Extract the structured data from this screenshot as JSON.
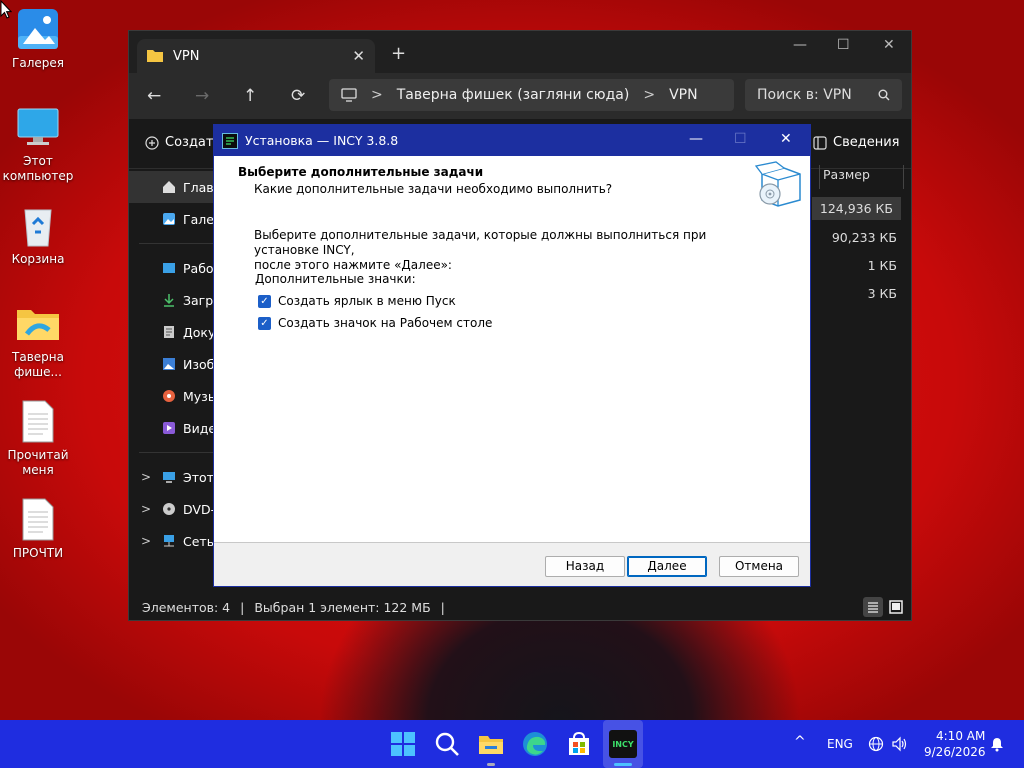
{
  "desktop": {
    "icons": [
      {
        "label": "Галерея",
        "icon": "gallery-icon"
      },
      {
        "label": "Этот компьютер",
        "icon": "this-pc-icon"
      },
      {
        "label": "Корзина",
        "icon": "recycle-bin-icon"
      },
      {
        "label": "Таверна фише...",
        "icon": "folder-icon"
      },
      {
        "label": "Прочитай меня",
        "icon": "text-document-icon"
      },
      {
        "label": "ПРОЧТИ",
        "icon": "text-document-icon"
      }
    ]
  },
  "explorer": {
    "tab_title": "VPN",
    "tab_close": "✕",
    "new_tab": "+",
    "window_controls": {
      "minimize": "—",
      "maximize": "☐",
      "close": "✕"
    },
    "nav": {
      "back": "←",
      "forward": "→",
      "up": "↑",
      "refresh": "⟳"
    },
    "address": {
      "root_icon": "monitor-icon",
      "segments": [
        "Таверна фишек (загляни сюда)",
        "VPN"
      ],
      "sep": ">"
    },
    "search_placeholder": "Поиск в: VPN",
    "toolbar": {
      "create_label": "Создать",
      "details_label": "Сведения"
    },
    "sidebar": [
      {
        "label": "Главная",
        "icon": "home-icon",
        "selected": true
      },
      {
        "label": "Галерея",
        "icon": "gallery-icon"
      },
      {
        "label": "Рабочий стол",
        "icon": "desktop-icon"
      },
      {
        "label": "Загрузки",
        "icon": "download-icon"
      },
      {
        "label": "Документы",
        "icon": "documents-icon"
      },
      {
        "label": "Изображения",
        "icon": "pictures-icon"
      },
      {
        "label": "Музыка",
        "icon": "music-icon"
      },
      {
        "label": "Видео",
        "icon": "video-icon"
      },
      {
        "label": "Этот компьютер",
        "icon": "this-pc-icon"
      },
      {
        "label": "DVD-дисковод",
        "icon": "dvd-icon"
      },
      {
        "label": "Сеть",
        "icon": "network-icon"
      }
    ],
    "sidebar_visible": [
      "Главн",
      "Галер",
      "Рабоч",
      "Загру",
      "Докум",
      "Изобр",
      "Музы",
      "Виде",
      "Этот к",
      "DVD-,",
      "Сеть"
    ],
    "column_header": "Размер",
    "sizes": [
      "124,936 КБ",
      "90,233 КБ",
      "1 КБ",
      "3 КБ"
    ],
    "status": {
      "items": "Элементов: 4",
      "sep": "|",
      "selected": "Выбран 1 элемент: 122 МБ"
    }
  },
  "dialog": {
    "title": "Установка — INCY 3.8.8",
    "app_icon_text": "INCY",
    "window_controls": {
      "minimize": "—",
      "maximize": "☐",
      "close": "✕"
    },
    "heading": "Выберите дополнительные задачи",
    "subheading": "Какие дополнительные задачи необходимо выполнить?",
    "description_line1": "Выберите дополнительные задачи, которые должны выполниться при установке INCY,",
    "description_line2": "после этого нажмите «Далее»:",
    "group_label": "Дополнительные значки:",
    "tasks": [
      {
        "label": "Создать ярлык в меню Пуск",
        "checked": true
      },
      {
        "label": "Создать значок на Рабочем столе",
        "checked": true
      }
    ],
    "buttons": {
      "back": "Назад",
      "next": "Далее",
      "cancel": "Отмена"
    }
  },
  "taskbar": {
    "apps": [
      "start-icon",
      "search-icon",
      "file-explorer-icon",
      "edge-icon",
      "store-icon",
      "incy-icon"
    ],
    "incy_label": "INCY",
    "tray": {
      "chevron": "^",
      "lang": "ENG",
      "time": "4:10 AM",
      "date": "9/26/2026"
    }
  },
  "colors": {
    "taskbar": "#1f2de0",
    "dialog_title": "#1c2fa0",
    "checkbox": "#1c5fc8",
    "wallpaper": "#d40c0c"
  }
}
